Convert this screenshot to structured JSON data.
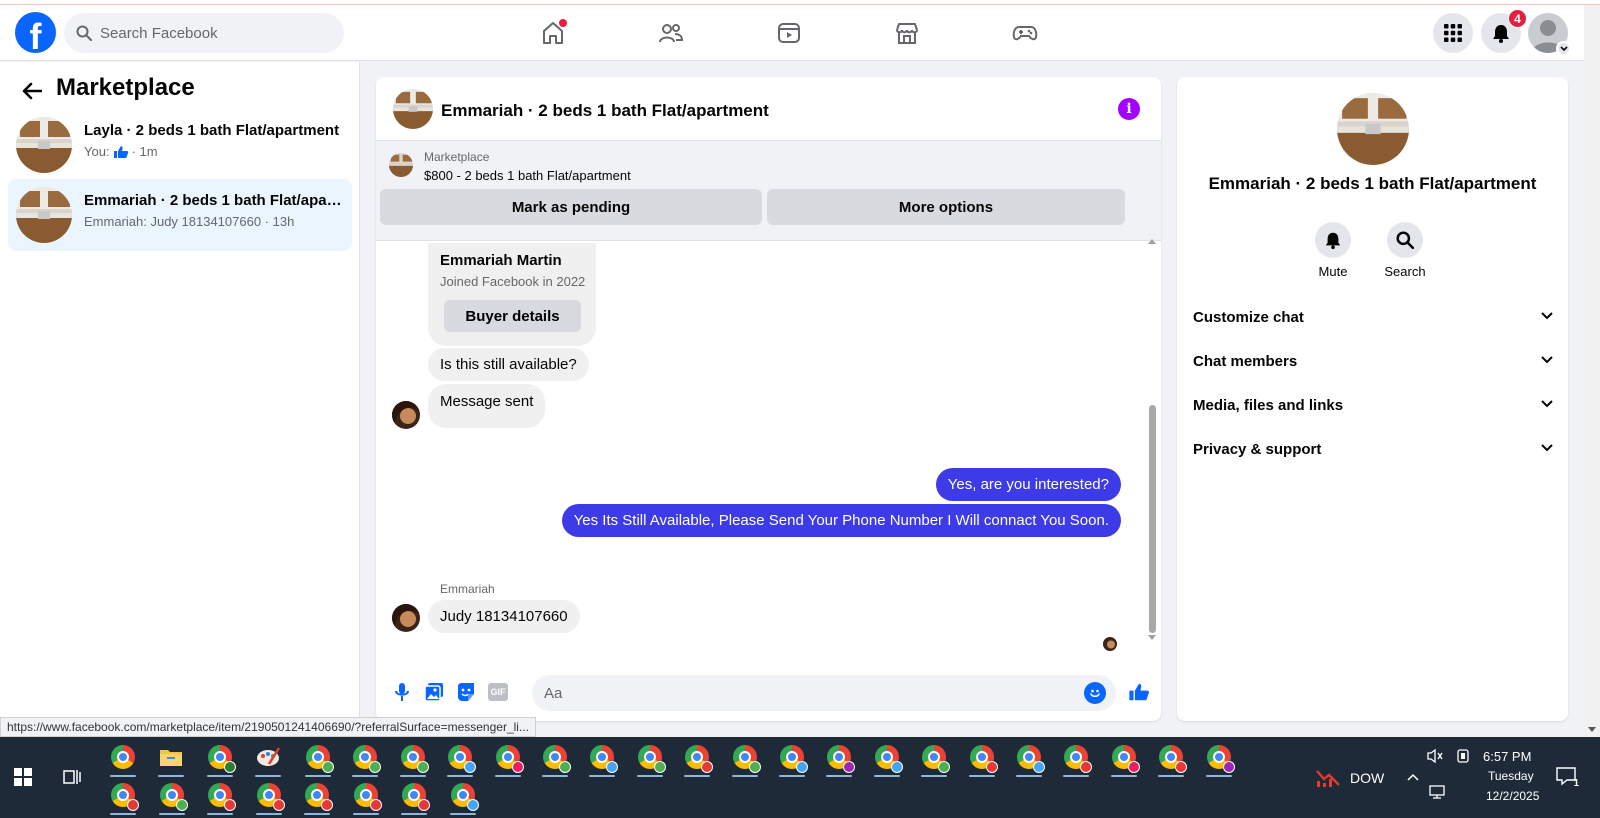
{
  "topnav": {
    "logo": "f",
    "search_placeholder": "Search Facebook",
    "nav_icons": [
      "home-icon",
      "friends-icon",
      "video-icon",
      "marketplace-icon",
      "gaming-icon"
    ],
    "notifications_count": "4",
    "accent_color": "#0866ff"
  },
  "sidebar": {
    "title": "Marketplace",
    "threads": [
      {
        "name": "Layla · 2 beds 1 bath Flat/apartment",
        "preview_prefix": "You:",
        "preview_suffix": "· 1m",
        "active": false
      },
      {
        "name": "Emmariah · 2 beds 1 bath Flat/apartment",
        "preview": "Emmariah: Judy 18134107660 · 13h",
        "active": true
      }
    ]
  },
  "conversation": {
    "title": "Emmariah · 2 beds 1 bath Flat/apartment",
    "listing": {
      "source": "Marketplace",
      "price_title": "$800 - 2 beds 1 bath Flat/apartment",
      "mark_pending_label": "Mark as pending",
      "more_options_label": "More options"
    },
    "buyer_card": {
      "name": "Emmariah Martin",
      "joined": "Joined Facebook in 2022",
      "details_label": "Buyer details"
    },
    "messages": {
      "m1": "Is this still available?",
      "m2": "Message sent",
      "m3": "Yes, are you interested?",
      "m4": "Yes Its Still Available, Please Send Your Phone Number I Will connact You Soon.",
      "sender_label": "Emmariah",
      "m5": "Judy 18134107660"
    },
    "composer": {
      "placeholder": "Aa",
      "icons": [
        "microphone-icon",
        "photo-icon",
        "sticker-icon",
        "gif-icon",
        "emoji-icon",
        "like-icon"
      ],
      "gif_label": "GIF"
    },
    "outgoing_color": "#3d3ae8",
    "info_color": "#a300ff"
  },
  "right_panel": {
    "title": "Emmariah · 2 beds 1 bath Flat/apartment",
    "mute_label": "Mute",
    "search_label": "Search",
    "sections": {
      "s1": "Customize chat",
      "s2": "Chat members",
      "s3": "Media, files and links",
      "s4": "Privacy & support"
    }
  },
  "status_url": "https://www.facebook.com/marketplace/item/2190501241406690/?referralSurface=messenger_li...",
  "taskbar": {
    "stock_label": "DOW",
    "time": "6:57 PM",
    "day": "Tuesday",
    "date": "12/2/2025",
    "notification_count": "1"
  }
}
